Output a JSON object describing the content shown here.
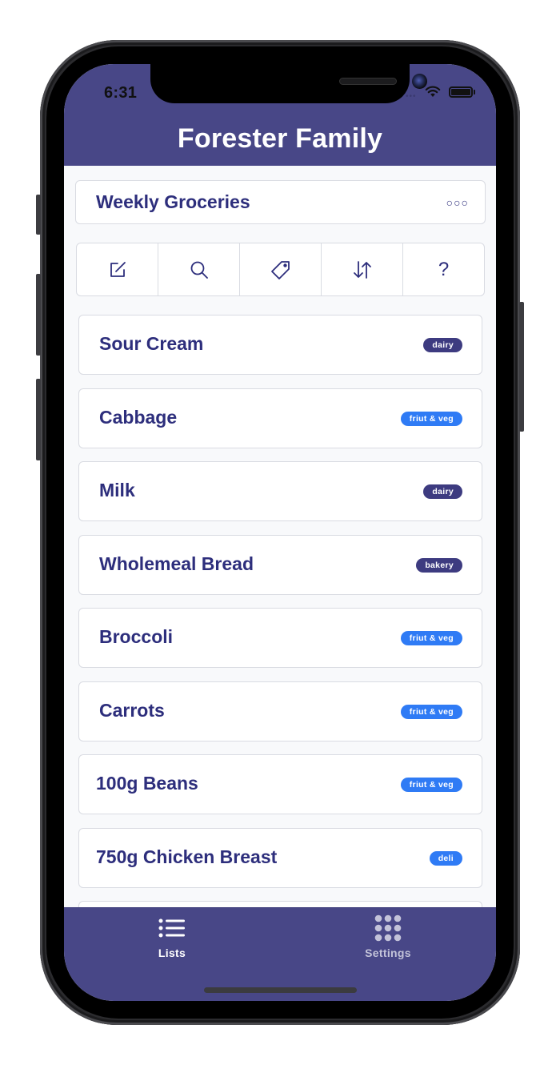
{
  "status_bar": {
    "time": "6:31"
  },
  "header": {
    "title": "Forester Family"
  },
  "list": {
    "name": "Weekly Groceries",
    "more_icon": "ellipsis-icon"
  },
  "toolbar": {
    "tools": [
      {
        "name": "edit",
        "icon": "compose-icon"
      },
      {
        "name": "search",
        "icon": "search-icon"
      },
      {
        "name": "tags",
        "icon": "tag-icon"
      },
      {
        "name": "sort",
        "icon": "sort-arrows-icon"
      },
      {
        "name": "help",
        "icon": "question-icon",
        "glyph": "?"
      }
    ]
  },
  "items": [
    {
      "name": "Sour Cream",
      "tag": "dairy",
      "tag_color": "#3d3b80"
    },
    {
      "name": "Cabbage",
      "tag": "friut & veg",
      "tag_color": "#2f7bf5"
    },
    {
      "name": "Milk",
      "tag": "dairy",
      "tag_color": "#3d3b80"
    },
    {
      "name": "Wholemeal Bread",
      "tag": "bakery",
      "tag_color": "#3d3b80"
    },
    {
      "name": "Broccoli",
      "tag": "friut & veg",
      "tag_color": "#2f7bf5"
    },
    {
      "name": "Carrots",
      "tag": "friut & veg",
      "tag_color": "#2f7bf5"
    },
    {
      "name": "100g Beans",
      "tag": "friut & veg",
      "tag_color": "#2f7bf5"
    },
    {
      "name": "750g Chicken Breast",
      "tag": "deli",
      "tag_color": "#2f7bf5"
    }
  ],
  "tabbar": {
    "tabs": [
      {
        "label": "Lists",
        "icon": "list-icon",
        "active": true
      },
      {
        "label": "Settings",
        "icon": "grid-icon",
        "active": false
      }
    ]
  },
  "colors": {
    "brand": "#484787",
    "text_primary": "#2d2e7c",
    "tag_dark": "#3d3b80",
    "tag_blue": "#2f7bf5",
    "background": "#f8f9fb"
  }
}
